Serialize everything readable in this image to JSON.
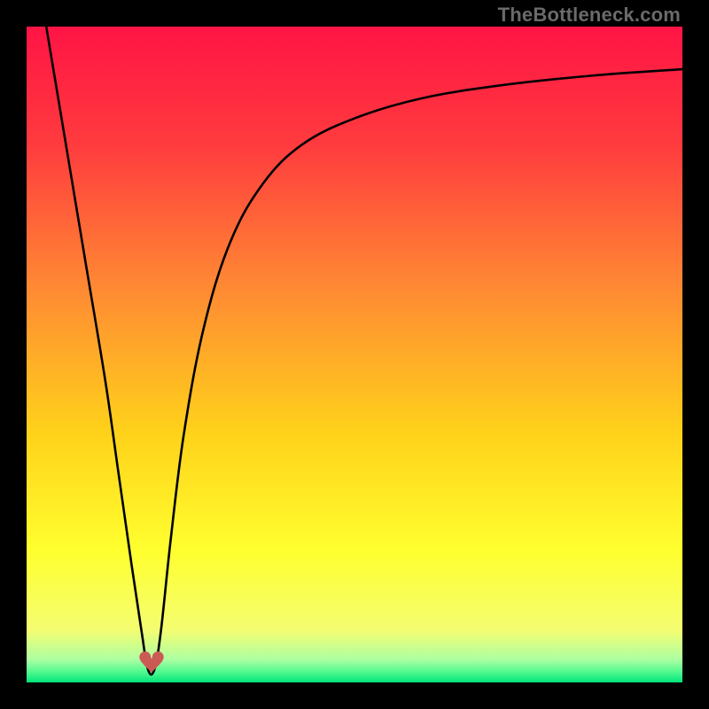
{
  "watermark": {
    "text": "TheBottleneck.com"
  },
  "chart_data": {
    "type": "line",
    "title": "",
    "xlabel": "",
    "ylabel": "",
    "xlim": [
      0,
      100
    ],
    "ylim": [
      0,
      100
    ],
    "grid": false,
    "legend": false,
    "gradient": {
      "direction": "top-to-bottom",
      "stops": [
        {
          "pos": 0.0,
          "color": "#ff1445"
        },
        {
          "pos": 0.18,
          "color": "#ff3b3e"
        },
        {
          "pos": 0.4,
          "color": "#ff8a33"
        },
        {
          "pos": 0.62,
          "color": "#ffd21a"
        },
        {
          "pos": 0.8,
          "color": "#ffff2f"
        },
        {
          "pos": 0.92,
          "color": "#f4fd71"
        },
        {
          "pos": 0.965,
          "color": "#adffa2"
        },
        {
          "pos": 0.985,
          "color": "#4cf88e"
        },
        {
          "pos": 1.0,
          "color": "#00e37a"
        }
      ]
    },
    "series": [
      {
        "name": "bottleneck-curve",
        "x": [
          3,
          6,
          9,
          12,
          14,
          16,
          17.5,
          18.5,
          19.5,
          20.5,
          22,
          24,
          27,
          31,
          36,
          42,
          50,
          60,
          72,
          86,
          100
        ],
        "values": [
          100,
          82,
          64,
          46,
          32,
          18,
          8,
          2,
          2,
          8,
          22,
          38,
          54,
          67,
          76,
          82,
          86,
          89,
          91,
          92.5,
          93.5
        ]
      }
    ],
    "annotations": [
      {
        "type": "heart-icon",
        "x": 19,
        "y": 2,
        "color": "#cc5a54"
      }
    ]
  }
}
